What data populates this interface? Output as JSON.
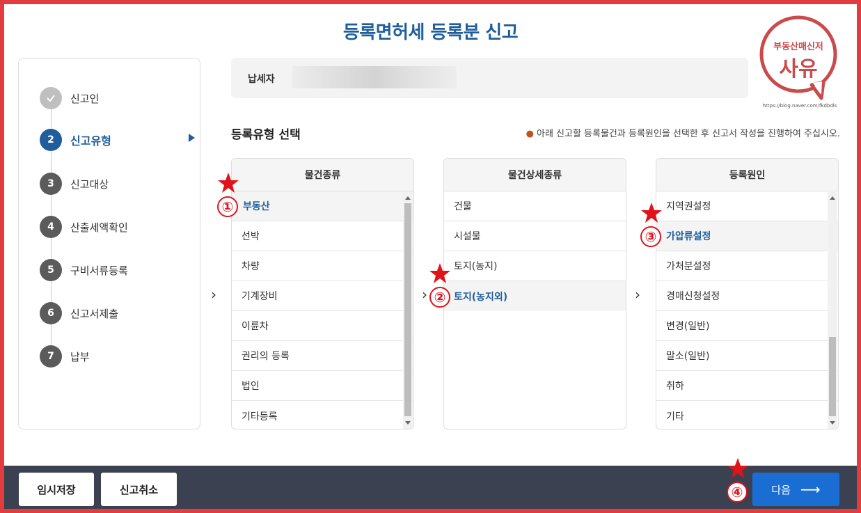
{
  "page_title": "등록면허세 등록분 신고",
  "logo": {
    "text_top": "부동산매신저",
    "text_main": "사유",
    "url": "https://blog.naver.com/fkdbdls"
  },
  "sidebar": {
    "steps": [
      {
        "num": "✓",
        "label": "신고인",
        "state": "done"
      },
      {
        "num": "2",
        "label": "신고유형",
        "state": "active"
      },
      {
        "num": "3",
        "label": "신고대상",
        "state": "pending"
      },
      {
        "num": "4",
        "label": "산출세액확인",
        "state": "pending"
      },
      {
        "num": "5",
        "label": "구비서류등록",
        "state": "pending"
      },
      {
        "num": "6",
        "label": "신고서제출",
        "state": "pending"
      },
      {
        "num": "7",
        "label": "납부",
        "state": "pending"
      }
    ]
  },
  "taxpayer": {
    "label": "납세자"
  },
  "section": {
    "title": "등록유형 선택",
    "note": "아래 신고할 등록물건과 등록원인을 선택한 후 신고서 작성을 진행하여 주십시오."
  },
  "columns": [
    {
      "header": "물건종류",
      "items": [
        "부동산",
        "선박",
        "차량",
        "기계장비",
        "이륜차",
        "권리의 등록",
        "법인",
        "기타등록"
      ],
      "selected": 0
    },
    {
      "header": "물건상세종류",
      "items": [
        "건물",
        "시설물",
        "토지(농지)",
        "토지(농지외)"
      ],
      "selected": 3
    },
    {
      "header": "등록원인",
      "items": [
        "지역권설정",
        "가압류설정",
        "가처분설정",
        "경매신청설정",
        "변경(일반)",
        "말소(일반)",
        "취하",
        "기타"
      ],
      "selected": 1
    }
  ],
  "chevron": "›",
  "bottom": {
    "temp_save": "임시저장",
    "cancel": "신고취소",
    "next": "다음",
    "next_arrow": "⟶"
  },
  "annotations": [
    "①",
    "②",
    "③",
    "④"
  ],
  "colors": {
    "brand": "#1f5d9c",
    "next_button": "#1a6ed3",
    "annotation": "#e0121a",
    "bottom_bar": "#3b4150"
  }
}
